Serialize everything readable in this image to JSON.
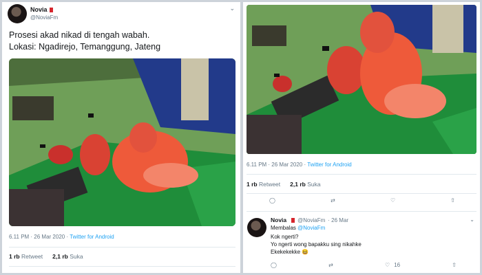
{
  "tweet": {
    "author_name": "Novia",
    "author_handle": "@NoviaFm",
    "text_line1": "Prosesi akad nikad di tengah wabah.",
    "text_line2": "Lokasi: Ngadirejo, Temanggung, Jateng",
    "time": "6.11 PM · 26 Mar 2020 · ",
    "source": "Twitter for Android",
    "retweets_count": "1 rb",
    "retweets_label": "Retweet",
    "likes_count": "2,1 rb",
    "likes_label": "Suka"
  },
  "reply": {
    "author_name": "Novia",
    "author_handle": "@NoviaFm",
    "date": "· 26 Mar",
    "replying_label": "Membalas",
    "replying_to": "@NoviaFm",
    "line1": "Kok ngerti?",
    "line2": "Yo ngerti wong bapakku sing nikahke",
    "line3": "Ekekekekke 😆",
    "likes": "16"
  },
  "colors": {
    "link": "#1da1f2",
    "muted": "#657786",
    "flag": "#d6262d"
  },
  "icons": [
    "chevron-down-icon",
    "reply-icon",
    "retweet-icon",
    "like-icon",
    "share-icon"
  ]
}
